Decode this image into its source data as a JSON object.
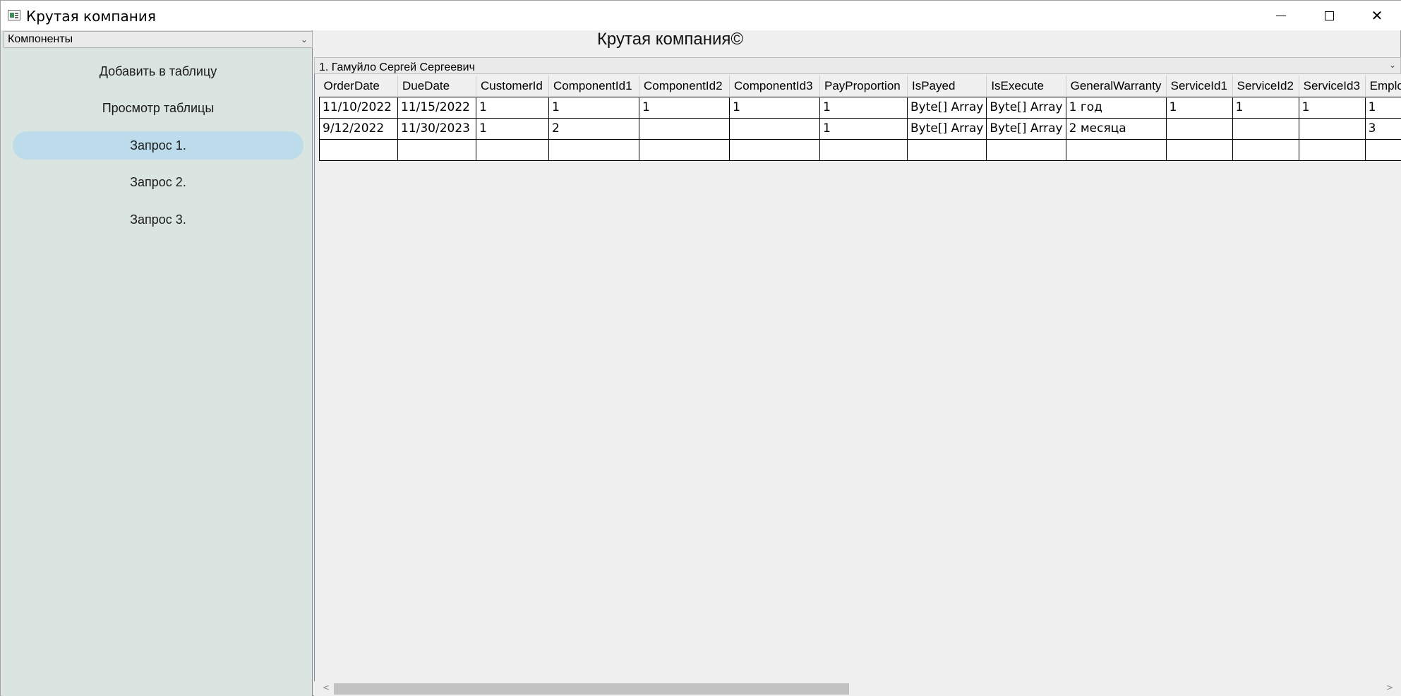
{
  "window": {
    "title": "Крутая компания",
    "controls": {
      "minimize": "—",
      "maximize": "☐",
      "close": "✕"
    }
  },
  "sidebar": {
    "combo_value": "Компоненты",
    "items": [
      {
        "label": "Добавить в таблицу",
        "selected": false
      },
      {
        "label": "Просмотр таблицы",
        "selected": false
      },
      {
        "label": "Запрос 1.",
        "selected": true
      },
      {
        "label": "Запрос 2.",
        "selected": false
      },
      {
        "label": "Запрос 3.",
        "selected": false
      }
    ]
  },
  "main": {
    "title": "Крутая компания©",
    "combo_value": "1. Гамуйло Сергей Сергеевич"
  },
  "grid": {
    "columns": [
      "OrderDate",
      "DueDate",
      "CustomerId",
      "ComponentId1",
      "ComponentId2",
      "ComponentId3",
      "PayProportion",
      "IsPayed",
      "IsExecute",
      "GeneralWarranty",
      "ServiceId1",
      "ServiceId2",
      "ServiceId3",
      "Emplo"
    ],
    "rows": [
      [
        "11/10/2022",
        "11/15/2022",
        "1",
        "1",
        "1",
        "1",
        "1",
        "Byte[] Array",
        "Byte[] Array",
        "1 год",
        "1",
        "1",
        "1",
        "1"
      ],
      [
        "9/12/2022",
        "11/30/2023",
        "1",
        "2",
        "",
        "",
        "1",
        "Byte[] Array",
        "Byte[] Array",
        "2 месяца",
        "",
        "",
        "",
        "3"
      ],
      [
        "",
        "",
        "",
        "",
        "",
        "",
        "",
        "",
        "",
        "",
        "",
        "",
        "",
        ""
      ]
    ]
  },
  "colors": {
    "sidebar_bg": "#dae4e1",
    "selected_item_bg": "#bcdcec",
    "grid_bg": "#efefef"
  }
}
